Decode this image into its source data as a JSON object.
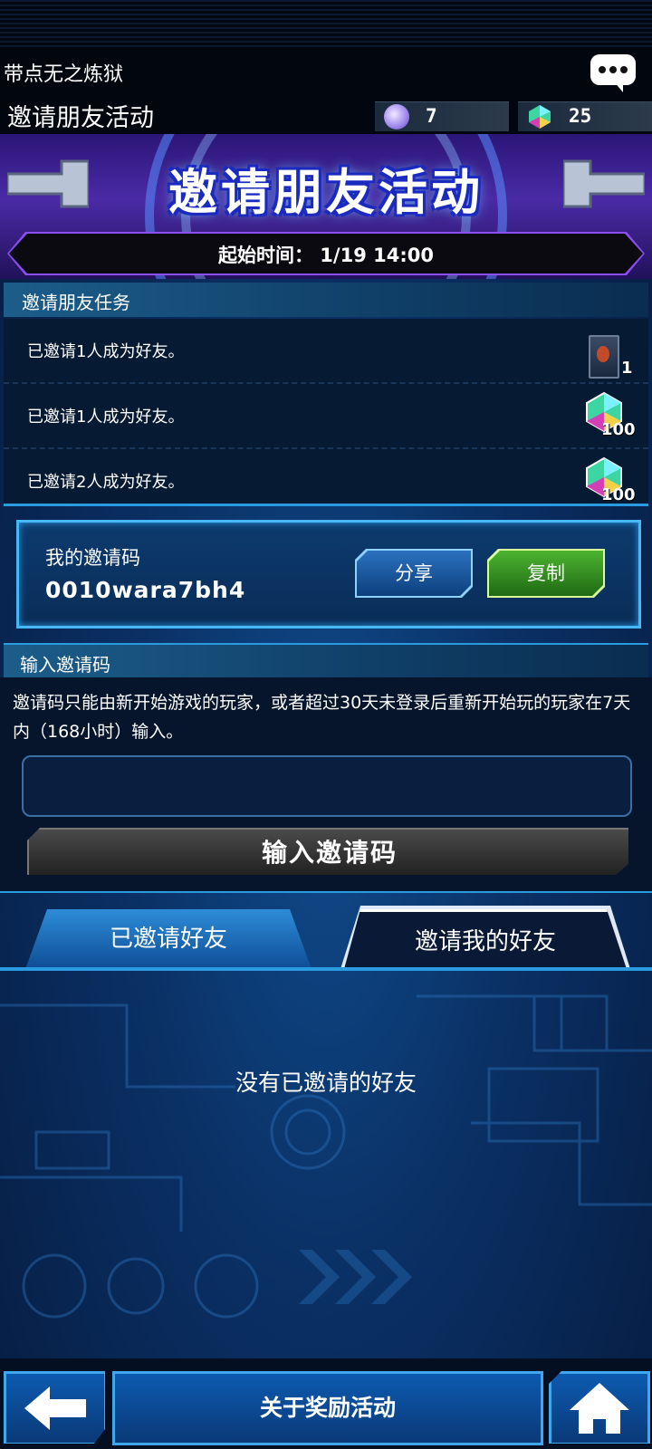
{
  "header": {
    "user_name": "带点无之炼狱",
    "page_title": "邀请朋友活动",
    "currency": [
      {
        "icon": "orb-icon",
        "value": "7"
      },
      {
        "icon": "gem-icon",
        "value": "25"
      }
    ]
  },
  "banner": {
    "title": "邀请朋友活动",
    "start_time": "起始时间： 1/19 14:00"
  },
  "tasks": {
    "header": "邀请朋友任务",
    "items": [
      {
        "text": "已邀请1人成为好友。",
        "reward_icon": "card-pack-icon",
        "qty": "1"
      },
      {
        "text": "已邀请1人成为好友。",
        "reward_icon": "gem-icon",
        "qty": "100"
      },
      {
        "text": "已邀请2人成为好友。",
        "reward_icon": "gem-icon",
        "qty": "100"
      }
    ]
  },
  "my_code": {
    "title": "我的邀请码",
    "value": "0010wara7bh4",
    "share_label": "分享",
    "copy_label": "复制"
  },
  "enter_code": {
    "header": "输入邀请码",
    "description": "邀请码只能由新开始游戏的玩家，或者超过30天未登录后重新开始玩的玩家在7天内（168小时）输入。",
    "input_value": "",
    "button_label": "输入邀请码"
  },
  "tabs": [
    {
      "label": "已邀请好友",
      "active": true
    },
    {
      "label": "邀请我的好友",
      "active": false
    }
  ],
  "empty_message": "没有已邀请的好友",
  "bottom": {
    "rewards_label": "关于奖励活动"
  },
  "colors": {
    "accent": "#2a9be0",
    "copy_green": "#4cb430",
    "banner_purple": "#4a2aa6"
  }
}
